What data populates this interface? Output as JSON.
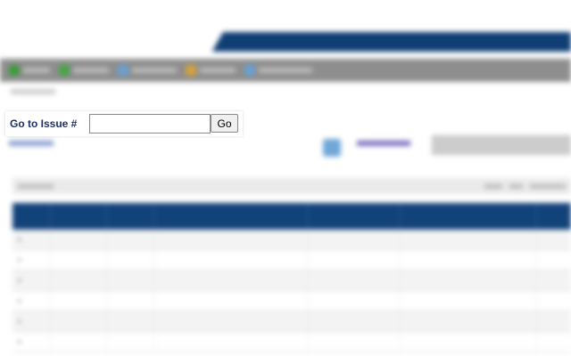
{
  "goto_issue": {
    "label": "Go to Issue #",
    "input_value": "",
    "button_label": "Go"
  },
  "colors": {
    "header_blue": "#0f3e74",
    "toolbar_gray": "#8e8e8e",
    "table_header_blue": "#12427a",
    "label_navy": "#1f2f6b"
  }
}
